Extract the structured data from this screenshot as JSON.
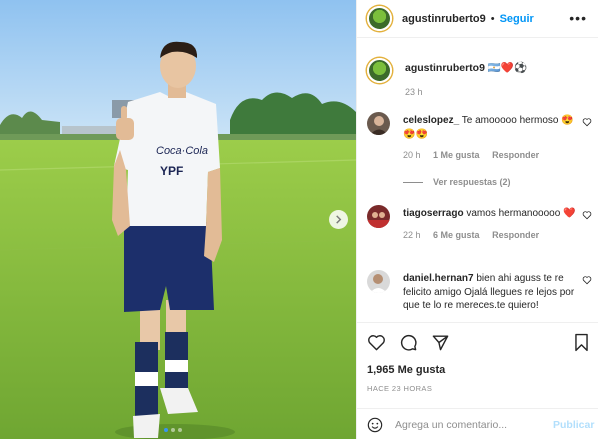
{
  "post": {
    "author": "agustinruberto9",
    "follow_label": "Seguir",
    "separator": "•",
    "more_icon": "more-horizontal-icon",
    "next_icon": "chevron-right-icon",
    "carousel_count": 3
  },
  "caption": {
    "username": "agustinruberto9",
    "emoji": "🇦🇷❤️⚽",
    "age": "23 h"
  },
  "comments": [
    {
      "username": "celeslopez_",
      "text": "Te amooooo hermoso 😍😍😍",
      "age": "20 h",
      "likes": "1 Me gusta",
      "reply": "Responder"
    },
    {
      "username": "tiagoserrago",
      "text": "vamos hermanooooo ❤️",
      "age": "22 h",
      "likes": "6 Me gusta",
      "reply": "Responder"
    },
    {
      "username": "daniel.hernan7",
      "text": "bien ahi aguss te re felicito amigo Ojalá llegues re lejos por que te lo re mereces.te quiero!",
      "age": "",
      "likes": "",
      "reply": ""
    }
  ],
  "view_replies": "Ver respuestas (2)",
  "footer": {
    "likes": "1,965 Me gusta",
    "time": "HACE 23 HORAS",
    "comment_placeholder": "Agrega un comentario...",
    "publish_label": "Publicar"
  },
  "colors": {
    "accent": "#0095f6",
    "muted": "#8e8e8e",
    "publish_disabled": "#b2dffc",
    "text": "#262626"
  }
}
